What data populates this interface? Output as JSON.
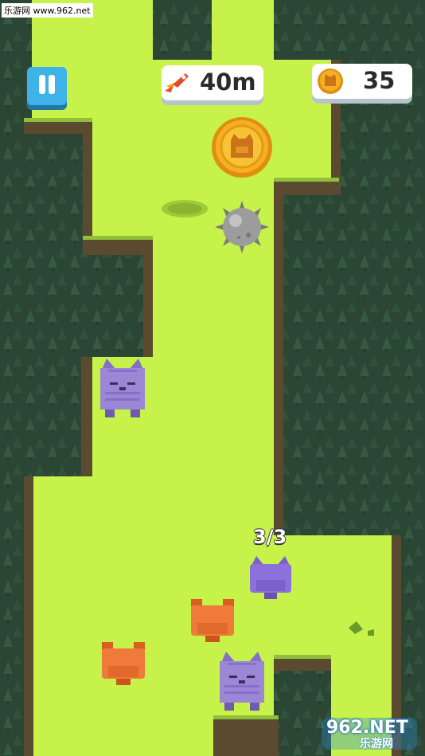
{
  "watermark_top": "乐游网 www.962.net",
  "hud": {
    "distance": "40m",
    "coins": "35",
    "distance_icon": "rocket-icon",
    "coin_icon": "coin-icon",
    "pause_icon": "pause-icon"
  },
  "counter": "3/3",
  "watermark_bottom": {
    "main": "962.NET",
    "sub": "乐游网"
  },
  "colors": {
    "path": "#c6f24a",
    "forest": "#2d4a36",
    "accent": "#3db3ea",
    "cat_purple": "#9b87d6",
    "cat_orange": "#f07a3a",
    "coin": "#f5b021"
  }
}
